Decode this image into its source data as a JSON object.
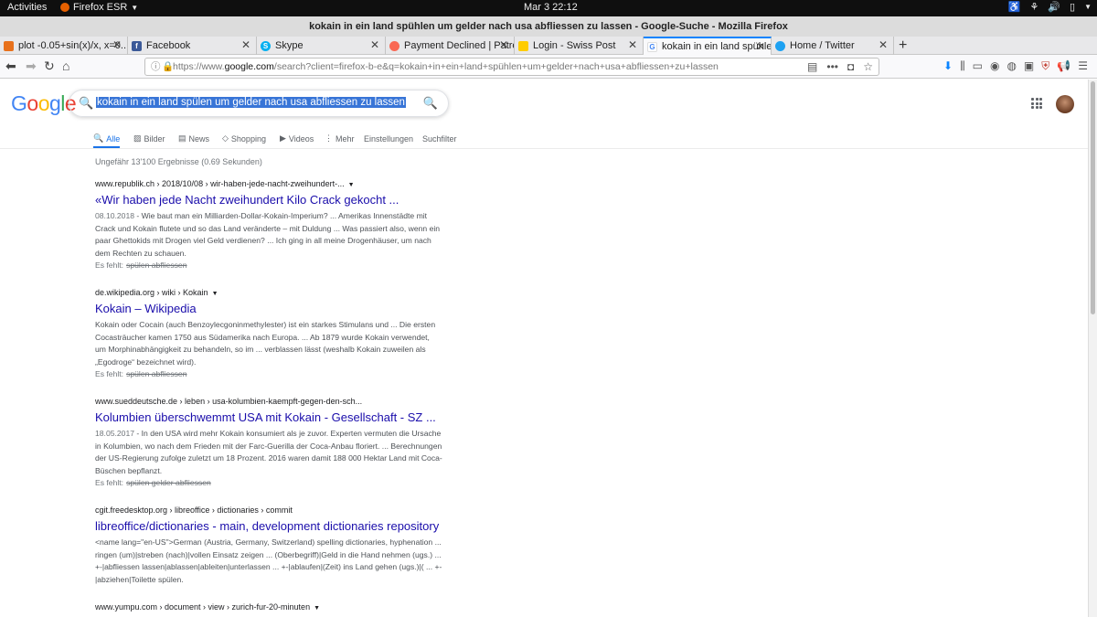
{
  "system": {
    "activities": "Activities",
    "app_name": "Firefox ESR",
    "clock": "Mar 3  22:12"
  },
  "window": {
    "title": "kokain in ein land spühlen um gelder nach usa abfliessen zu lassen - Google-Suche - Mozilla Firefox"
  },
  "tabs": [
    {
      "label": "plot -0.05+sin(x)/x, x=0..",
      "favicon_color": "#e8711c"
    },
    {
      "label": "Facebook",
      "favicon_color": "#3b5998"
    },
    {
      "label": "Skype",
      "favicon_color": "#00aff0"
    },
    {
      "label": "Payment Declined | Patreon",
      "favicon_color": "#f96854"
    },
    {
      "label": "Login - Swiss Post",
      "favicon_color": "#ffcc00"
    },
    {
      "label": "kokain in ein land spühlen",
      "favicon_color": "#4285f4"
    },
    {
      "label": "Home / Twitter",
      "favicon_color": "#1da1f2"
    }
  ],
  "urlbar": {
    "prefix": "https://www.",
    "domain": "google.com",
    "rest": "/search?client=firefox-b-e&q=kokain+in+ein+land+spühlen+um+gelder+nach+usa+abfliessen+zu+lassen"
  },
  "search": {
    "query": "kokain in ein land spülen um gelder nach usa abfliessen zu lassen"
  },
  "google_tabs": [
    "Alle",
    "Bilder",
    "News",
    "Shopping",
    "Videos",
    "Mehr",
    "Einstellungen",
    "Suchfilter"
  ],
  "stats": "Ungefähr 13'100 Ergebnisse (0.69 Sekunden)",
  "results": [
    {
      "cite": "www.republik.ch › 2018/10/08 › wir-haben-jede-nacht-zweihundert-...",
      "title": "«Wir haben jede Nacht zweihundert Kilo Crack gekocht ...",
      "date": "08.10.2018",
      "snippet": "Wie baut man ein Milliarden-Dollar-Kokain-Imperium? ... Amerikas Innenstädte mit Crack und Kokain flutete und so das Land veränderte – mit Duldung ... Was passiert also, wenn ein paar Ghettokids mit Drogen viel Geld verdienen? ... Ich ging in all meine Drogenhäuser, um nach dem Rechten zu schauen.",
      "missing_label": "Es fehlt:",
      "missing": "spülen abfliessen"
    },
    {
      "cite": "de.wikipedia.org › wiki › Kokain",
      "title": "Kokain – Wikipedia",
      "date": "",
      "snippet": "Kokain oder Cocain (auch Benzoylecgoninmethylester) ist ein starkes Stimulans und ... Die ersten Cocasträucher kamen 1750 aus Südamerika nach Europa. ... Ab 1879 wurde Kokain verwendet, um Morphinabhängigkeit zu behandeln, so im ... verblassen lässt (weshalb Kokain zuweilen als „Egodroge“ bezeichnet wird).",
      "missing_label": "Es fehlt:",
      "missing": "spülen abfliessen"
    },
    {
      "cite": "www.sueddeutsche.de › leben › usa-kolumbien-kaempft-gegen-den-sch...",
      "title": "Kolumbien überschwemmt USA mit Kokain - Gesellschaft - SZ ...",
      "date": "18.05.2017",
      "snippet": "In den USA wird mehr Kokain konsumiert als je zuvor. Experten vermuten die Ursache in Kolumbien, wo nach dem Frieden mit der Farc-Guerilla der Coca-Anbau floriert. ... Berechnungen der US-Regierung zufolge zuletzt um 18 Prozent. 2016 waren damit 188 000 Hektar Land mit Coca-Büschen bepflanzt.",
      "missing_label": "Es fehlt:",
      "missing": "spülen gelder abfliessen"
    },
    {
      "cite": "cgit.freedesktop.org › libreoffice › dictionaries › commit",
      "title": "libreoffice/dictionaries - main, development dictionaries repository",
      "date": "",
      "snippet": "<name lang=\"en-US\">German (Austria, Germany, Switzerland) spelling dictionaries, hyphenation ... ringen (um)|streben (nach)|vollen Einsatz zeigen ... (Oberbegriff)|Geld in die Hand nehmen (ugs.) ... +-|abfliessen lassen|ablassen|ableiten|unterlassen ... +-|ablaufen|(Zeit) ins Land gehen (ugs.)|( ... +-|abziehen|Toilette spülen.",
      "missing_label": "",
      "missing": ""
    },
    {
      "cite": "www.yumpu.com › document › view › zurich-fur-20-minuten",
      "title": "",
      "date": "",
      "snippet": "",
      "missing_label": "",
      "missing": ""
    }
  ]
}
